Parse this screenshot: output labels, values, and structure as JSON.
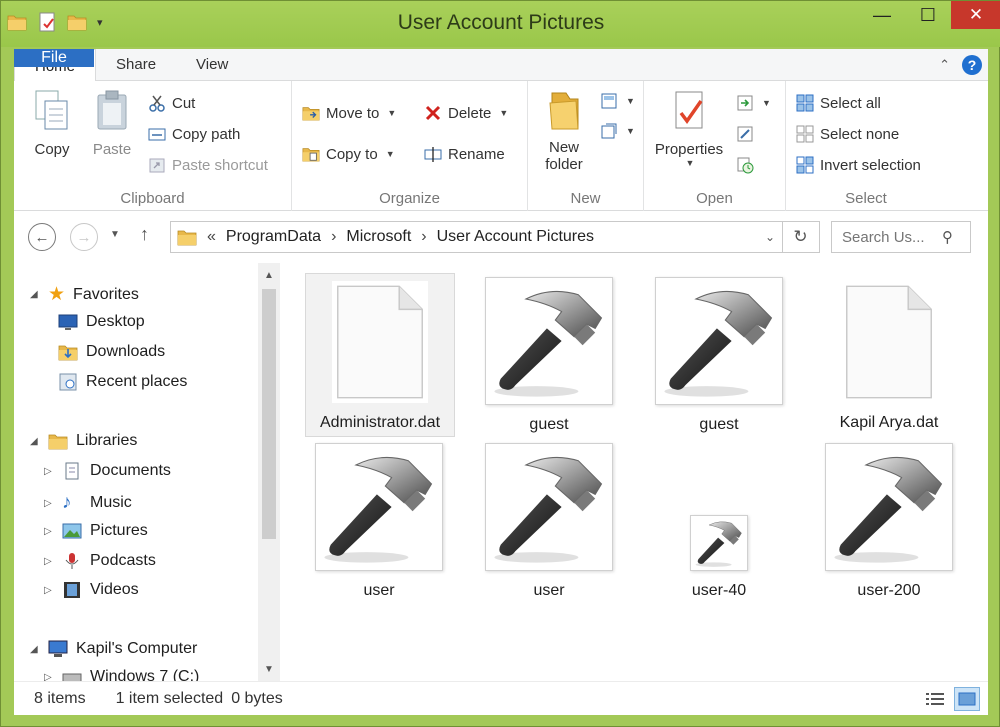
{
  "window": {
    "title": "User Account Pictures",
    "minimize": "—",
    "maximize": "☐",
    "close": "✕"
  },
  "tabs": {
    "file": "File",
    "home": "Home",
    "share": "Share",
    "view": "View"
  },
  "ribbon": {
    "clipboard": {
      "label": "Clipboard",
      "copy": "Copy",
      "paste": "Paste",
      "cut": "Cut",
      "copy_path": "Copy path",
      "paste_shortcut": "Paste shortcut"
    },
    "organize": {
      "label": "Organize",
      "move_to": "Move to",
      "copy_to": "Copy to",
      "delete": "Delete",
      "rename": "Rename"
    },
    "new": {
      "label": "New",
      "new_folder_line1": "New",
      "new_folder_line2": "folder"
    },
    "open": {
      "label": "Open",
      "properties": "Properties"
    },
    "select": {
      "label": "Select",
      "select_all": "Select all",
      "select_none": "Select none",
      "invert_selection": "Invert selection"
    }
  },
  "address": {
    "overflow": "«",
    "crumbs": [
      "ProgramData",
      "Microsoft",
      "User Account Pictures"
    ],
    "search_placeholder": "Search Us..."
  },
  "nav": {
    "favorites": "Favorites",
    "desktop": "Desktop",
    "downloads": "Downloads",
    "recent_places": "Recent places",
    "libraries": "Libraries",
    "documents": "Documents",
    "music": "Music",
    "pictures": "Pictures",
    "podcasts": "Podcasts",
    "videos": "Videos",
    "computer": "Kapil's Computer",
    "drive_c": "Windows 7 (C:)"
  },
  "files": [
    {
      "name": "Administrator.dat",
      "kind": "dat",
      "selected": true
    },
    {
      "name": "guest",
      "kind": "image"
    },
    {
      "name": "guest",
      "kind": "image"
    },
    {
      "name": "Kapil Arya.dat",
      "kind": "dat"
    },
    {
      "name": "user",
      "kind": "image"
    },
    {
      "name": "user",
      "kind": "image"
    },
    {
      "name": "user-40",
      "kind": "image-small"
    },
    {
      "name": "user-200",
      "kind": "image"
    }
  ],
  "status": {
    "count": "8 items",
    "selection": "1 item selected",
    "size": "0 bytes"
  },
  "colors": {
    "accent": "#2c6fc4",
    "title_bar": "#9ac74a",
    "close": "#c7372b"
  }
}
